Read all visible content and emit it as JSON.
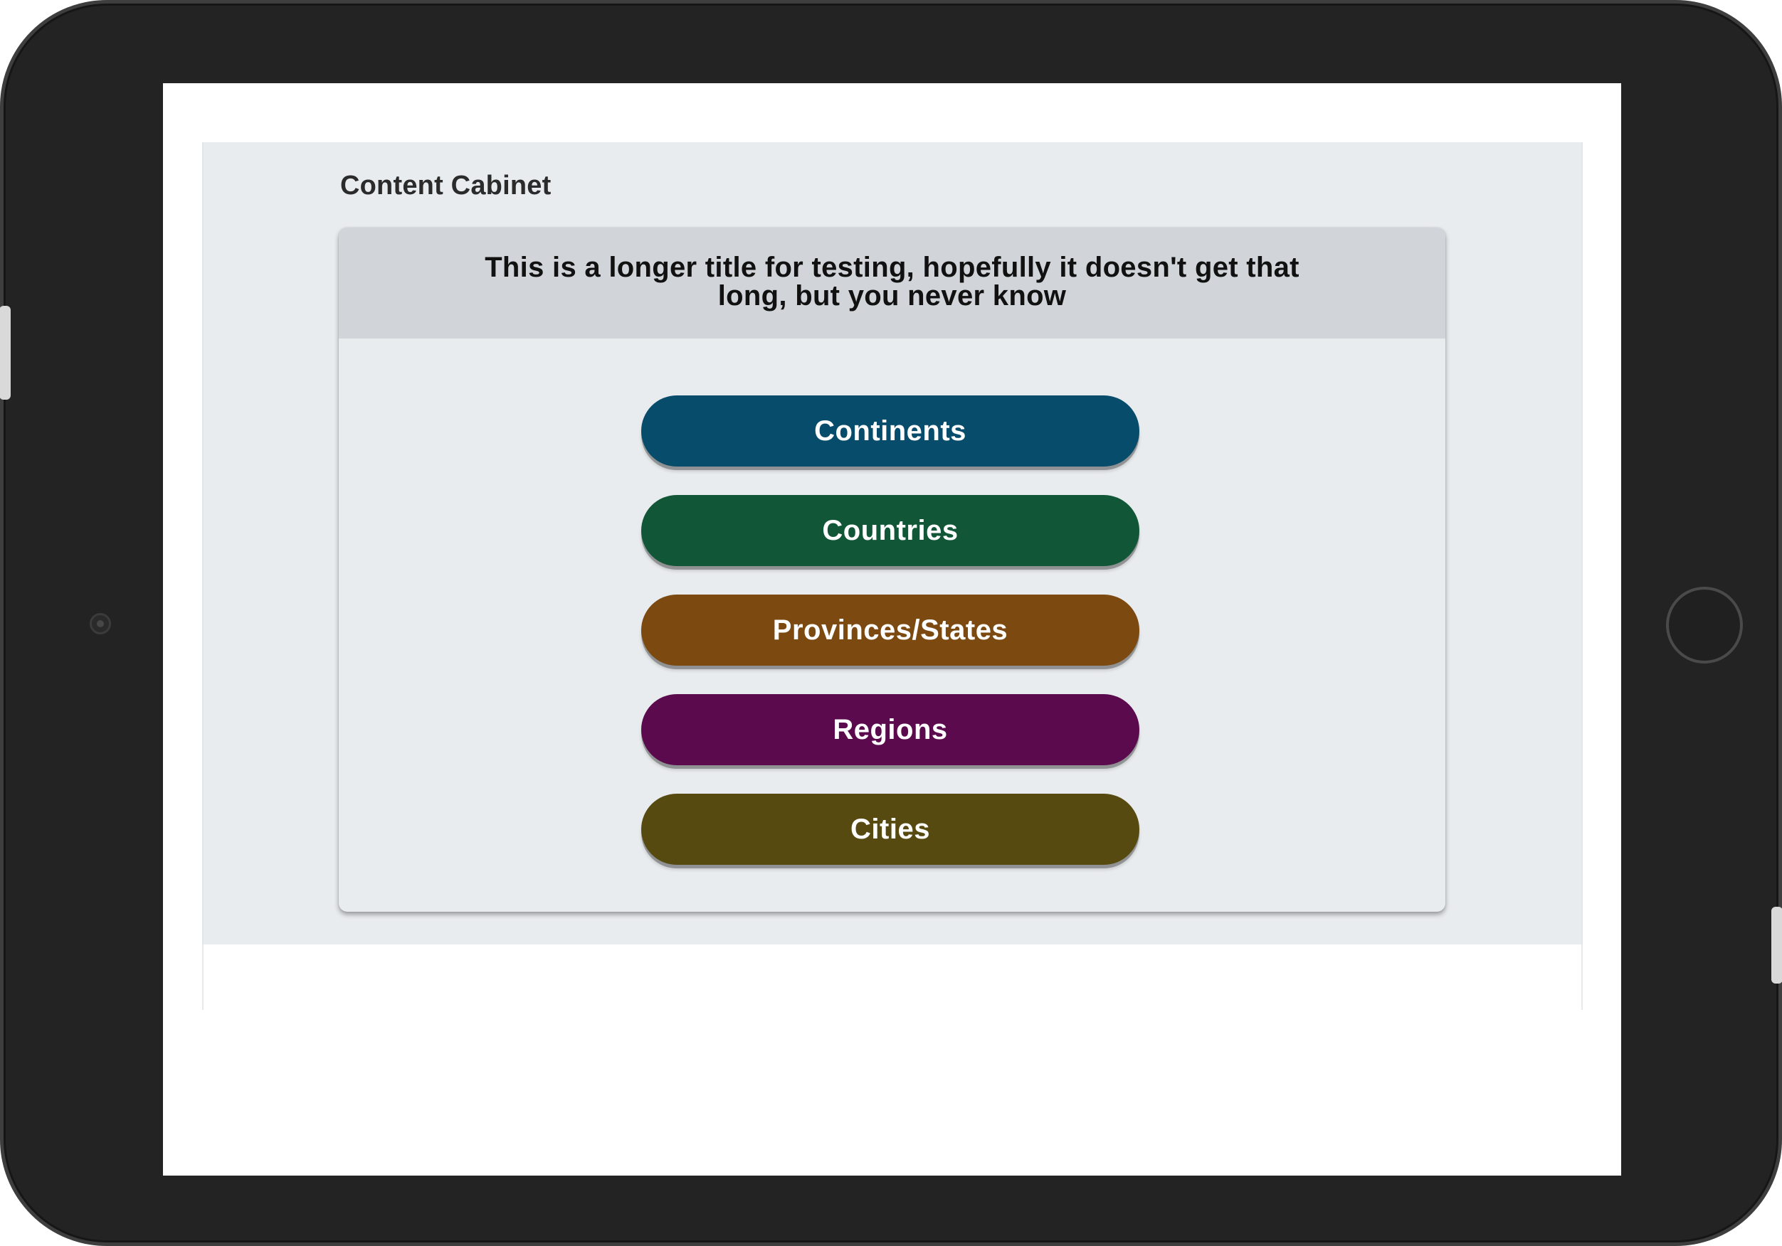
{
  "app": {
    "page_title": "Content Cabinet",
    "card_title": "This is a longer title for testing, hopefully it doesn't get that long, but you never know"
  },
  "categories": [
    {
      "label": "Continents",
      "color": "#084C6B"
    },
    {
      "label": "Countries",
      "color": "#115737"
    },
    {
      "label": "Provinces/States",
      "color": "#7C4910"
    },
    {
      "label": "Regions",
      "color": "#5B0B4D"
    },
    {
      "label": "Cities",
      "color": "#574A10"
    }
  ],
  "colors": {
    "device_frame": "#232323",
    "panel_background": "#E9ECEE",
    "card_header": "#D1D5D9"
  },
  "icons": {
    "front_camera": "camera-icon",
    "home_button": "home-button-icon"
  }
}
